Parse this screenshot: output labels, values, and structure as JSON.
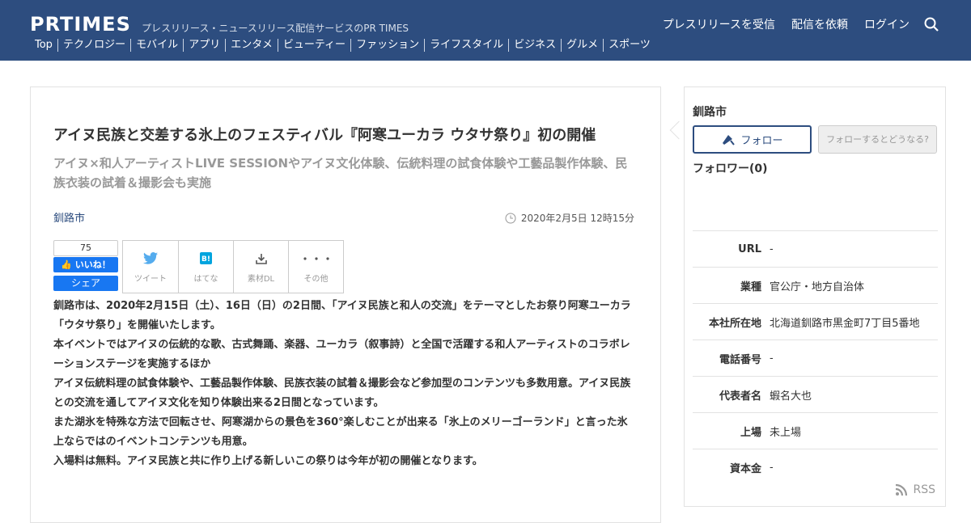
{
  "header": {
    "logo": "PRTIMES",
    "tagline": "プレスリリース・ニュースリリース配信サービスのPR TIMES",
    "categories": [
      "Top",
      "テクノロジー",
      "モバイル",
      "アプリ",
      "エンタメ",
      "ビューティー",
      "ファッション",
      "ライフスタイル",
      "ビジネス",
      "グルメ",
      "スポーツ"
    ],
    "nav": [
      "プレスリリースを受信",
      "配信を依頼",
      "ログイン"
    ]
  },
  "article": {
    "title": "アイヌ民族と交差する氷上のフェスティバル『阿寒ユーカラ ウタサ祭り』初の開催",
    "subtitle": "アイヌ×和人アーティストLIVE SESSIONやアイヌ文化体験、伝統料理の試食体験や工藝品製作体験、民族衣装の試着＆撮影会も実施",
    "company": "釧路市",
    "date": "2020年2月5日 12時15分",
    "like_count": "75",
    "like_label": "いいね！",
    "share_label": "シェア",
    "share_items": [
      "ツイート",
      "はてな",
      "素材DL",
      "その他"
    ],
    "body": [
      "釧路市は、2020年2月15日（土）、16日（日）の2日間、「アイヌ民族と和人の交流」をテーマとしたお祭り阿寒ユーカラ「ウタサ祭り」を開催いたします。",
      "本イベントではアイヌの伝統的な歌、古式舞踊、楽器、ユーカラ（叙事詩）と全国で活躍する和人アーティストのコラボレーションステージを実施するほか",
      "アイヌ伝統料理の試食体験や、工藝品製作体験、民族衣装の試着＆撮影会など参加型のコンテンツも多数用意。アイヌ民族との交流を通してアイヌ文化を知り体験出来る2日間となっています。",
      "また湖氷を特殊な方法で回転させ、阿寒湖からの景色を360°楽しむことが出来る「氷上のメリーゴーランド」と言った氷上ならではのイベントコンテンツも用意。",
      "入場料は無料。アイヌ民族と共に作り上げる新しいこの祭りは今年が初の開催となります。"
    ]
  },
  "sidebar": {
    "name": "釧路市",
    "follow": "フォロー",
    "follow_help": "フォローするとどうなる?",
    "followers": "フォロワー(0)",
    "info": [
      {
        "key": "URL",
        "value": "-"
      },
      {
        "key": "業種",
        "value": "官公庁・地方自治体"
      },
      {
        "key": "本社所在地",
        "value": "北海道釧路市黒金町7丁目5番地"
      },
      {
        "key": "電話番号",
        "value": "-"
      },
      {
        "key": "代表者名",
        "value": "蝦名大也"
      },
      {
        "key": "上場",
        "value": "未上場"
      },
      {
        "key": "資本金",
        "value": "-"
      }
    ],
    "rss": "RSS"
  }
}
